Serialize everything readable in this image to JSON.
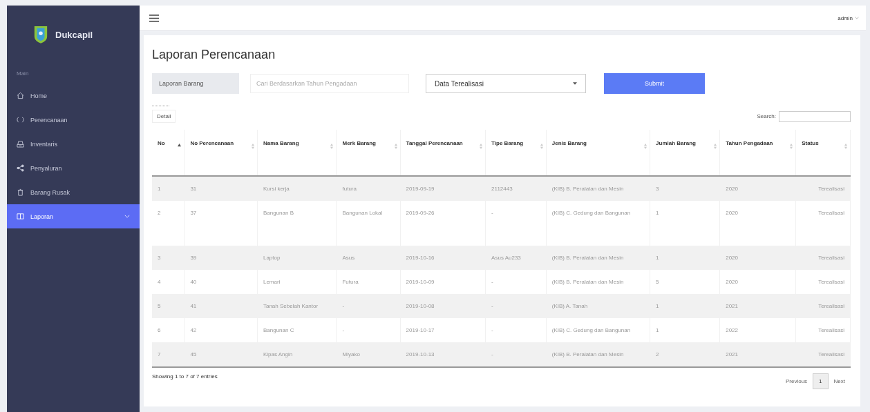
{
  "sidebar": {
    "brand": "Dukcapil",
    "section_label": "Main",
    "items": [
      {
        "label": "Home",
        "selected": false,
        "has_submenu": false
      },
      {
        "label": "Perencanaan",
        "selected": false,
        "has_submenu": false
      },
      {
        "label": "Inventaris",
        "selected": false,
        "has_submenu": false
      },
      {
        "label": "Penyaluran",
        "selected": false,
        "has_submenu": false
      },
      {
        "label": "Barang Rusak",
        "selected": false,
        "has_submenu": false
      },
      {
        "label": "Laporan",
        "selected": true,
        "has_submenu": true
      }
    ]
  },
  "topbar": {
    "user": "admin"
  },
  "page": {
    "title": "Laporan Perencanaan",
    "filters": {
      "label": "Laporan Barang",
      "search": {
        "placeholder": "Cari Berdasarkan Tahun Pengadaan"
      },
      "select": {
        "value": "Data Terealisasi"
      },
      "submit": "Submit"
    },
    "detail_button": "Detail",
    "search_label": "Search:",
    "table": {
      "columns": [
        {
          "label": "No",
          "sorted": true
        },
        {
          "label": "No Perencanaan",
          "sorted": false
        },
        {
          "label": "Nama Barang",
          "sorted": false
        },
        {
          "label": "Merk Barang",
          "sorted": false
        },
        {
          "label": "Tanggal Perencanaan",
          "sorted": false
        },
        {
          "label": "Tipe Barang",
          "sorted": false
        },
        {
          "label": "Jenis Barang",
          "sorted": false
        },
        {
          "label": "Jumlah Barang",
          "sorted": false
        },
        {
          "label": "Tahun Pengadaan",
          "sorted": false
        },
        {
          "label": "Status",
          "sorted": false
        }
      ],
      "rows": [
        [
          "1",
          "31",
          "Kursi kerja",
          "futura",
          "2019-09-19",
          "2112443",
          "(KIB) B. Peralatan dan Mesin",
          "3",
          "2020",
          "Terealisasi"
        ],
        [
          "2",
          "37",
          "Bangunan B",
          "Bangunan Lokal",
          "2019-09-26",
          "-",
          "(KIB) C. Gedung dan Bangunan",
          "1",
          "2020",
          "Terealisasi"
        ],
        [
          "3",
          "39",
          "Laptop",
          "Asus",
          "2019-10-16",
          "Asus Au233",
          "(KIB) B. Peralatan dan Mesin",
          "1",
          "2020",
          "Terealisasi"
        ],
        [
          "4",
          "40",
          "Lemari",
          "Futura",
          "2019-10-09",
          "-",
          "(KIB) B. Peralatan dan Mesin",
          "5",
          "2020",
          "Terealisasi"
        ],
        [
          "5",
          "41",
          "Tanah Sebelah Kantor",
          "-",
          "2019-10-08",
          "-",
          "(KIB) A. Tanah",
          "1",
          "2021",
          "Terealisasi"
        ],
        [
          "6",
          "42",
          "Bangunan C",
          "-",
          "2019-10-17",
          "-",
          "(KIB) C. Gedung dan Bangunan",
          "1",
          "2022",
          "Terealisasi"
        ],
        [
          "7",
          "45",
          "Kipas Angin",
          "Miyako",
          "2019-10-13",
          "-",
          "(KIB) B. Peralatan dan Mesin",
          "2",
          "2021",
          "Terealisasi"
        ]
      ]
    },
    "info": "Showing 1 to 7 of 7 entries",
    "pagination": {
      "previous": "Previous",
      "pages": [
        {
          "label": "1",
          "selected": true
        }
      ],
      "next": "Next"
    }
  }
}
